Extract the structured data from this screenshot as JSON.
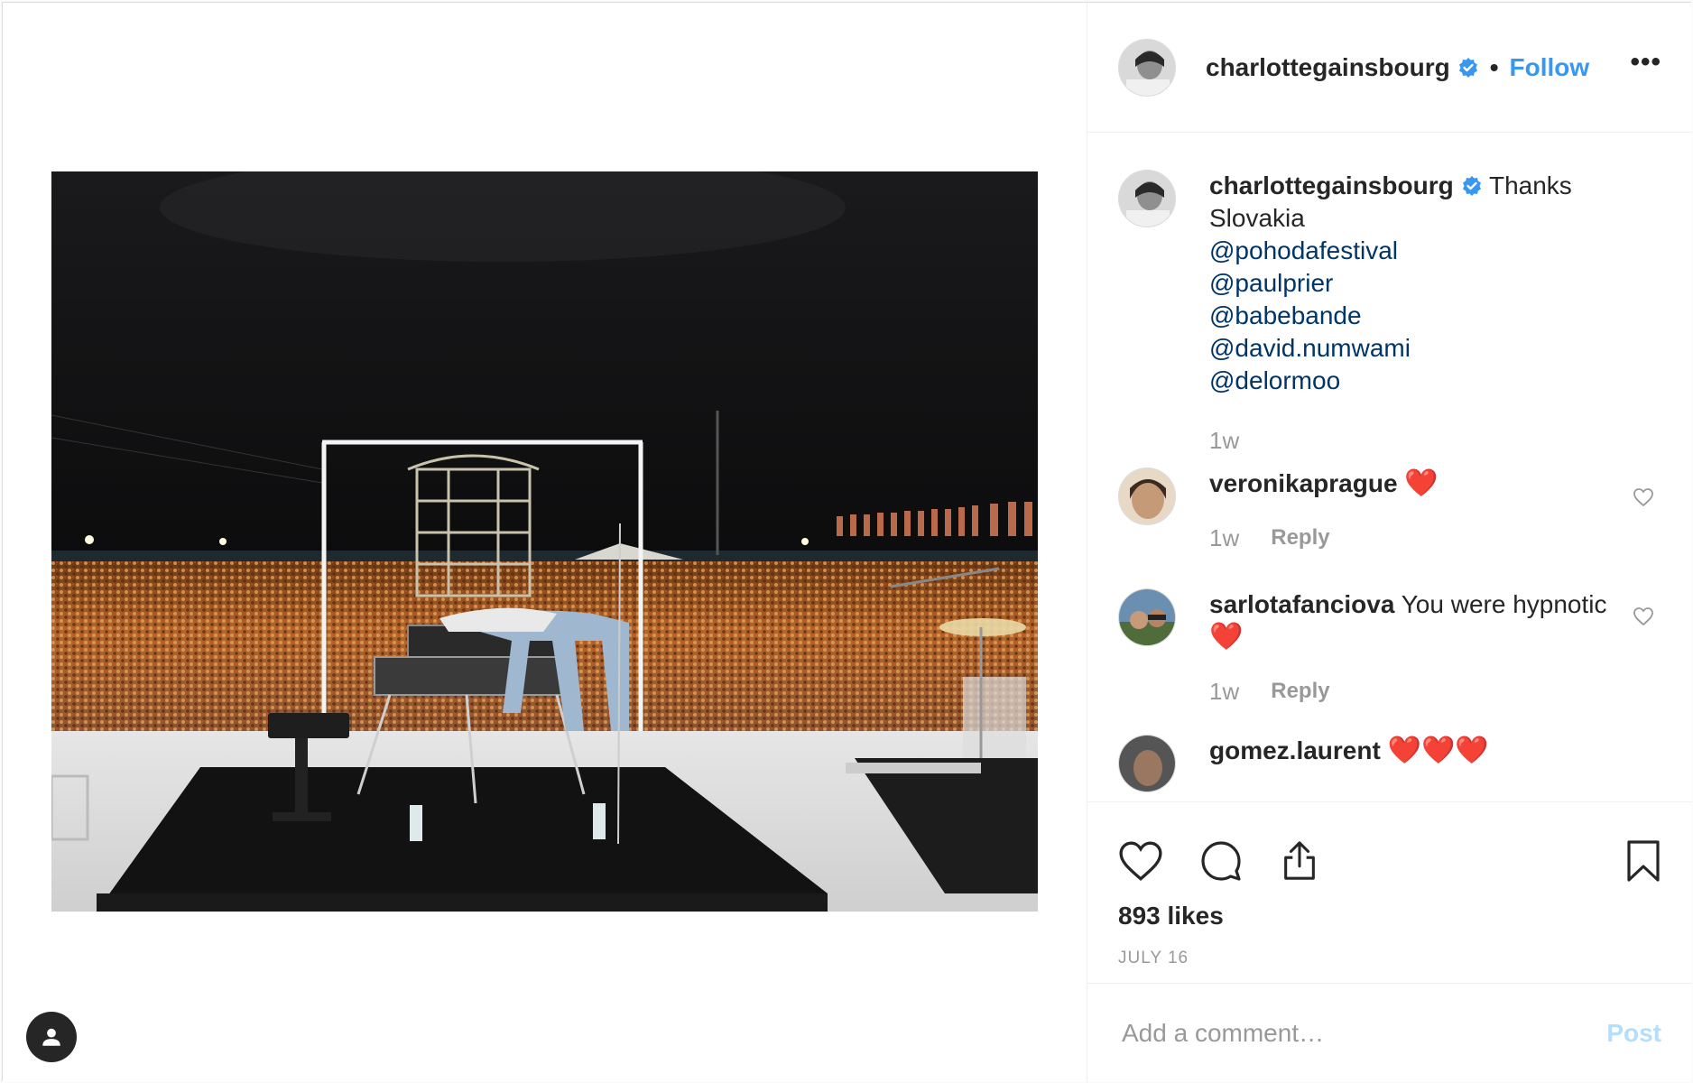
{
  "post": {
    "author": "charlottegainsbourg",
    "follow_label": "Follow",
    "separator": "•",
    "more_label": "•••",
    "caption": {
      "user": "charlottegainsbourg",
      "text": "Thanks Slovakia",
      "mentions": [
        "@pohodafestival",
        "@paulprier",
        "@babebande",
        "@david.numwami",
        "@delormoo"
      ],
      "time": "1w"
    },
    "comments": [
      {
        "user": "veronikaprague",
        "text": "",
        "emoji": "❤️",
        "time": "1w",
        "reply_label": "Reply"
      },
      {
        "user": "sarlotafanciova",
        "text": "You were hypnotic",
        "emoji": "❤️",
        "time": "1w",
        "reply_label": "Reply"
      },
      {
        "user": "gomez.laurent",
        "text": "",
        "emoji": "❤️❤️❤️",
        "time": "",
        "reply_label": ""
      }
    ],
    "likes": "893 likes",
    "date": "JULY 16",
    "comment_input_placeholder": "Add a comment…",
    "post_label": "Post"
  },
  "colors": {
    "accent": "#3897f0",
    "mention": "#003569",
    "heart": "#e0245e",
    "muted": "#999999"
  },
  "icons": [
    "user-icon",
    "verified-badge-icon",
    "heart-icon",
    "comment-icon",
    "share-icon",
    "bookmark-icon",
    "heart-small-icon"
  ]
}
